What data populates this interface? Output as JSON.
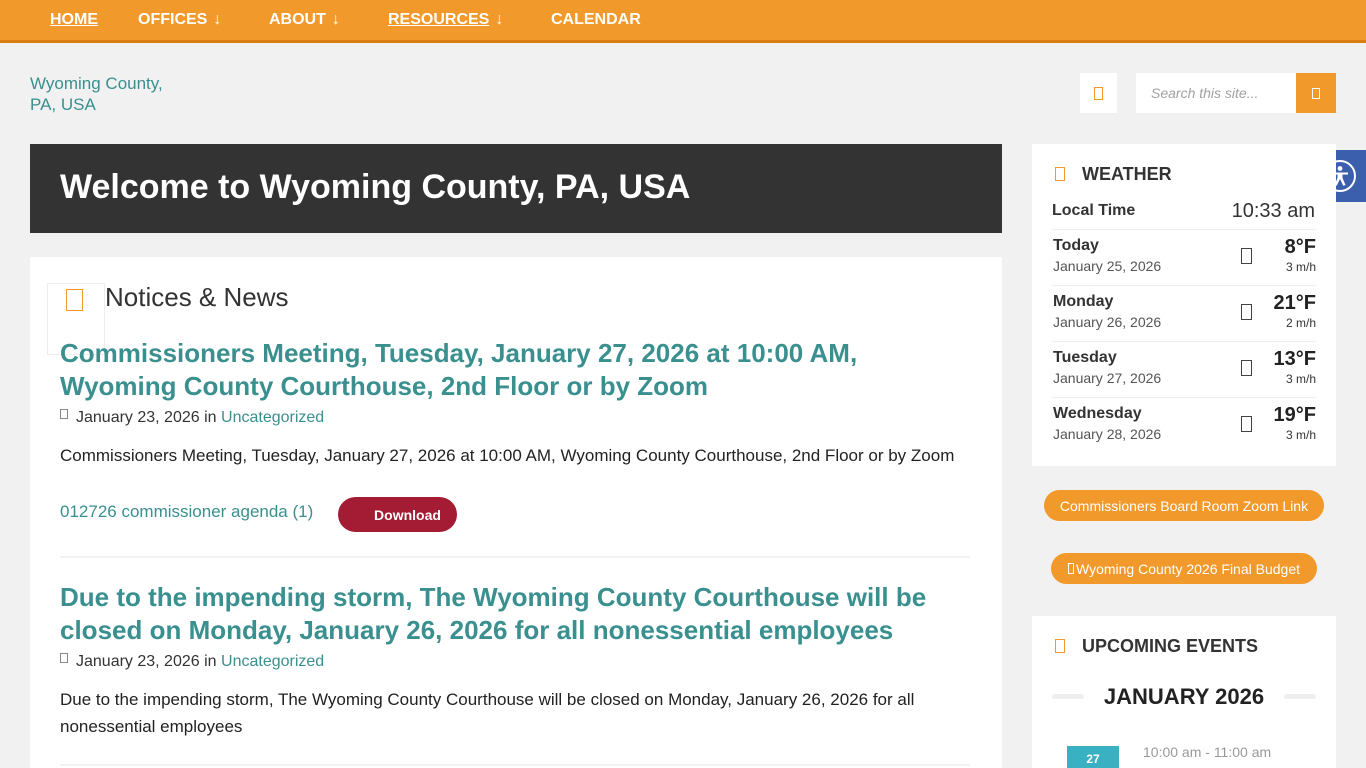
{
  "nav": {
    "items": [
      {
        "label": "HOME",
        "arrow": ""
      },
      {
        "label": "OFFICES",
        "arrow": "↓"
      },
      {
        "label": "ABOUT",
        "arrow": "↓"
      },
      {
        "label": "RESOURCES",
        "arrow": "↓"
      },
      {
        "label": "CALENDAR",
        "arrow": ""
      }
    ]
  },
  "header": {
    "logo_alt": "Wyoming County, PA, USA",
    "search_placeholder": "Search this site..."
  },
  "page": {
    "title": "Welcome to Wyoming County, PA, USA"
  },
  "news": {
    "section_title": "Notices & News",
    "in_label": "in",
    "posts": [
      {
        "title": "Commissioners Meeting, Tuesday, January 27, 2026 at 10:00 AM, Wyoming County Courthouse, 2nd Floor or by Zoom",
        "date": "January 23, 2026",
        "category": "Uncategorized",
        "excerpt": "Commissioners Meeting, Tuesday, January 27, 2026 at 10:00 AM, Wyoming County Courthouse, 2nd Floor or by Zoom",
        "file_name": "012726 commissioner agenda (1)",
        "download_label": "Download"
      },
      {
        "title": "Due to the impending storm, The Wyoming County Courthouse will be closed on Monday, January 26, 2026 for all nonessential employees",
        "date": "January 23, 2026",
        "category": "Uncategorized",
        "excerpt": "Due to the impending storm, The Wyoming County Courthouse will be closed on Monday, January 26, 2026 for all nonessential employees"
      }
    ]
  },
  "weather": {
    "title": "WEATHER",
    "local_time_label": "Local Time",
    "local_time": "10:33 am",
    "days": [
      {
        "day": "Today",
        "date": "January 25, 2026",
        "temp": "8°F",
        "wind": "3 m/h"
      },
      {
        "day": "Monday",
        "date": "January 26, 2026",
        "temp": "21°F",
        "wind": "2 m/h"
      },
      {
        "day": "Tuesday",
        "date": "January 27, 2026",
        "temp": "13°F",
        "wind": "3 m/h"
      },
      {
        "day": "Wednesday",
        "date": "January 28, 2026",
        "temp": "19°F",
        "wind": "3 m/h"
      }
    ]
  },
  "buttons": {
    "zoom_link": "Commissioners Board Room Zoom Link",
    "budget": "Wyoming County 2026 Final Budget"
  },
  "events": {
    "title": "UPCOMING EVENTS",
    "month": "JANUARY 2026",
    "first_day": "27",
    "first_time": "10:00 am - 11:00 am"
  },
  "colors": {
    "accent": "#f2992b",
    "link": "#3a8f8f",
    "download": "#a31c34",
    "banner": "#333333",
    "accessibility": "#3b5fad"
  }
}
